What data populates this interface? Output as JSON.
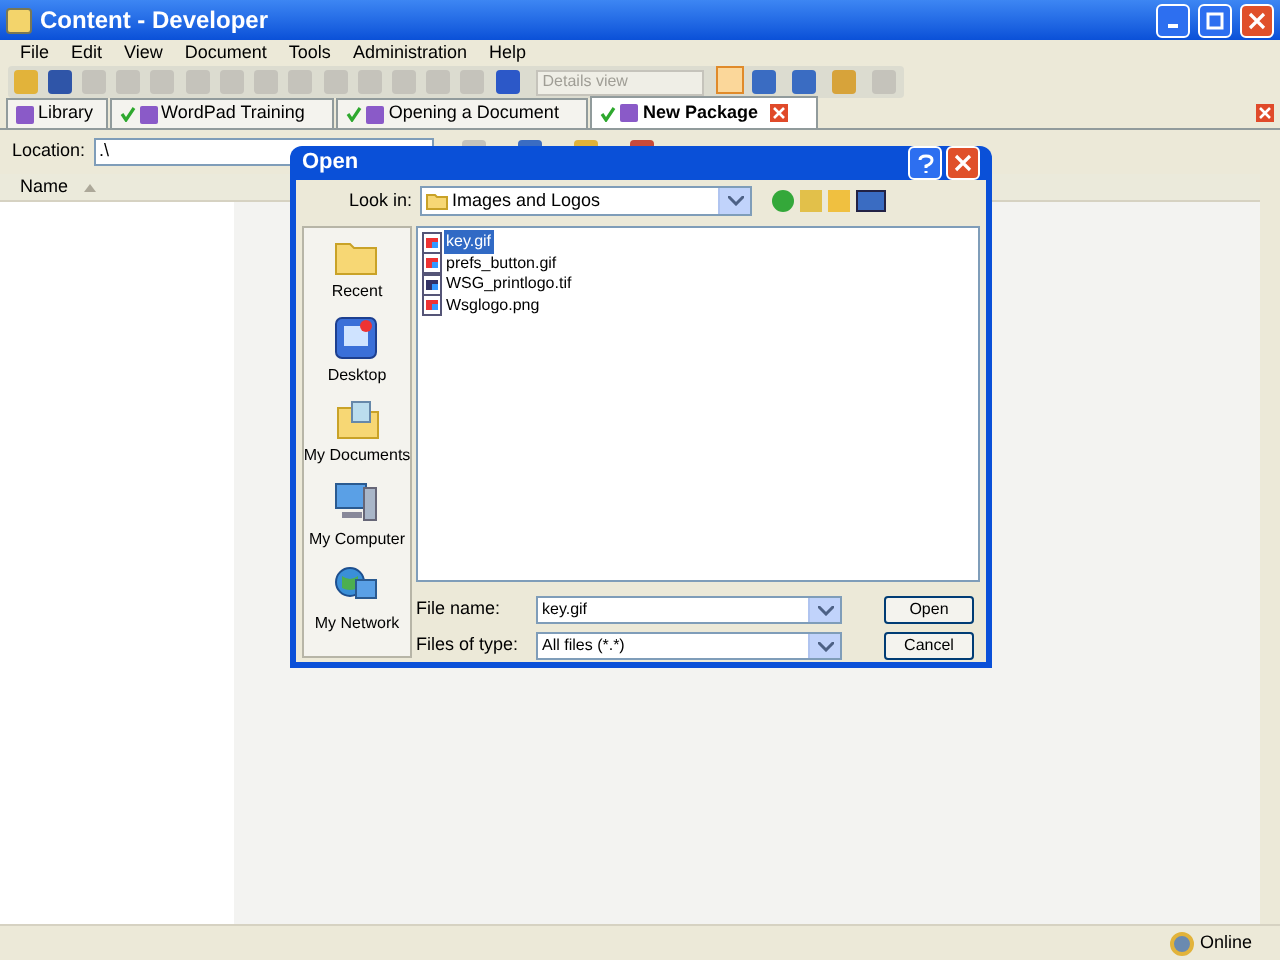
{
  "window": {
    "title": "Content - Developer"
  },
  "menu": [
    "File",
    "Edit",
    "View",
    "Document",
    "Tools",
    "Administration",
    "Help"
  ],
  "toolbar": {
    "view_select": {
      "value": "Details view",
      "disabled": true
    }
  },
  "tabs": [
    {
      "label": "Library",
      "checked": false,
      "selected": false,
      "closable": false
    },
    {
      "label": "WordPad Training",
      "checked": true,
      "selected": false,
      "closable": false
    },
    {
      "label": "Opening a Document",
      "checked": true,
      "selected": false,
      "closable": false
    },
    {
      "label": "New Package",
      "checked": true,
      "selected": true,
      "closable": true
    }
  ],
  "location": {
    "label": "Location:",
    "value": ".\\"
  },
  "list_header": {
    "column": "Name"
  },
  "dialog": {
    "title": "Open",
    "look_in_label": "Look in:",
    "look_in_value": "Images and Logos",
    "places": [
      {
        "label": "Recent",
        "kind": "recent"
      },
      {
        "label": "Desktop",
        "kind": "desktop"
      },
      {
        "label": "My Documents",
        "kind": "documents"
      },
      {
        "label": "My Computer",
        "kind": "computer"
      },
      {
        "label": "My Network",
        "kind": "network"
      }
    ],
    "files": [
      {
        "name": "key.gif",
        "kind": "image",
        "selected": true
      },
      {
        "name": "prefs_button.gif",
        "kind": "image",
        "selected": false
      },
      {
        "name": "WSG_printlogo.tif",
        "kind": "tif",
        "selected": false
      },
      {
        "name": "Wsglogo.png",
        "kind": "image",
        "selected": false
      }
    ],
    "file_name_label": "File name:",
    "file_name_value": "key.gif",
    "file_type_label": "Files of type:",
    "file_type_value": "All files (*.*)",
    "buttons": [
      "Open",
      "Cancel"
    ]
  },
  "status_bar": {
    "text": "Online"
  }
}
